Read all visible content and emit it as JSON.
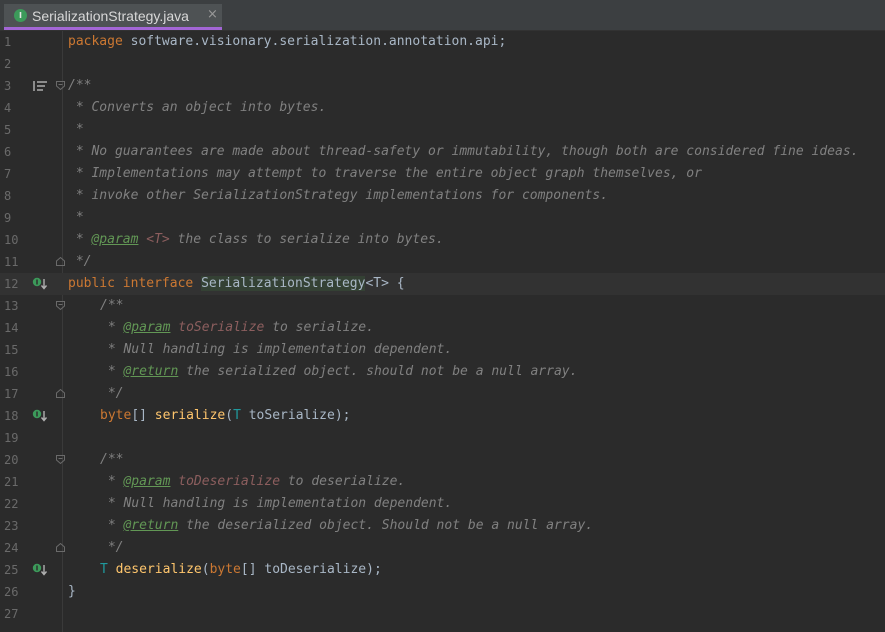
{
  "tab": {
    "title": "SerializationStrategy.java",
    "close": "×"
  },
  "lines": [
    {
      "n": "1"
    },
    {
      "n": "2"
    },
    {
      "n": "3"
    },
    {
      "n": "4"
    },
    {
      "n": "5"
    },
    {
      "n": "6"
    },
    {
      "n": "7"
    },
    {
      "n": "8"
    },
    {
      "n": "9"
    },
    {
      "n": "10"
    },
    {
      "n": "11"
    },
    {
      "n": "12"
    },
    {
      "n": "13"
    },
    {
      "n": "14"
    },
    {
      "n": "15"
    },
    {
      "n": "16"
    },
    {
      "n": "17"
    },
    {
      "n": "18"
    },
    {
      "n": "19"
    },
    {
      "n": "20"
    },
    {
      "n": "21"
    },
    {
      "n": "22"
    },
    {
      "n": "23"
    },
    {
      "n": "24"
    },
    {
      "n": "25"
    },
    {
      "n": "26"
    },
    {
      "n": "27"
    }
  ],
  "code": {
    "l1_kw": "package",
    "l1_rest": " software.visionary.serialization.annotation.api;",
    "l3": "/**",
    "l4": " * Converts an object into bytes.",
    "l5": " *",
    "l6": " * No guarantees are made about thread-safety or immutability, though both are considered fine ideas.",
    "l7": " * Implementations may attempt to traverse the entire object graph themselves, or",
    "l8": " * invoke other SerializationStrategy implementations for components.",
    "l9": " *",
    "l10_pre": " * ",
    "l10_tag": "@param",
    "l10_t": "<T>",
    "l10_rest": " the class to serialize into bytes.",
    "l11": " */",
    "l12_kw1": "public",
    "l12_kw2": "interface",
    "l12_name": "SerializationStrategy",
    "l12_gen": "<T>",
    "l12_brace": " {",
    "l13": "/**",
    "l14_tag": "@param",
    "l14_arg": "toSerialize",
    "l14_rest": " to serialize.",
    "l15": " * Null handling is implementation dependent.",
    "l16_tag": "@return",
    "l16_rest": " the serialized object. should not be a null array.",
    "l17": " */",
    "l18_kw": "byte",
    "l18_br": "[] ",
    "l18_fn": "serialize",
    "l18_open": "(",
    "l18_t": "T",
    "l18_rest": " toSerialize);",
    "l20": "/**",
    "l21_tag": "@param",
    "l21_arg": "toDeserialize",
    "l21_rest": " to deserialize.",
    "l22": " * Null handling is implementation dependent.",
    "l23_tag": "@return",
    "l23_rest": " the deserialized object. Should not be a null array.",
    "l24": " */",
    "l25_t": "T",
    "l25_fn": "deserialize",
    "l25_open": "(",
    "l25_kw": "byte",
    "l25_rest": "[] toDeserialize);",
    "l26": "}",
    "star": " * "
  },
  "gutter_icons": {
    "line3": "javadoc-render-icon",
    "line12": "implemented-interface-icon",
    "line18": "implemented-method-icon",
    "line25": "implemented-method-icon"
  }
}
